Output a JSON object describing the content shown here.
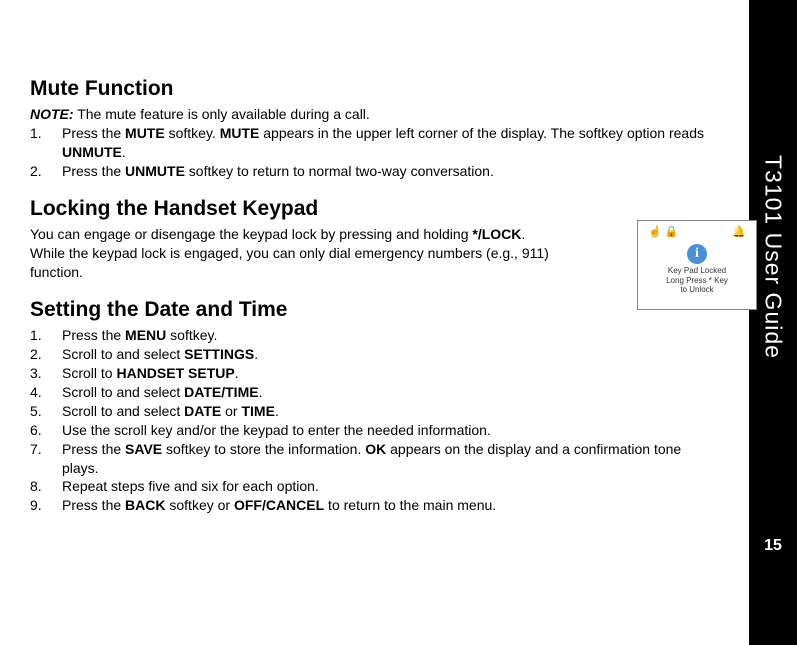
{
  "sidebar": {
    "title": "T3101 User Guide",
    "page_number": "15"
  },
  "section1": {
    "heading": "Mute Function",
    "note_label": "NOTE:",
    "note_text": " The mute feature is only available during a call.",
    "steps": [
      {
        "num": "1.",
        "pre": "Press the ",
        "b1": "MUTE",
        "mid1": " softkey. ",
        "b2": "MUTE",
        "mid2": " appears in the upper left corner of the display. The softkey option reads ",
        "b3": "UNMUTE",
        "post": "."
      },
      {
        "num": "2.",
        "pre": "Press the ",
        "b1": "UNMUTE",
        "mid1": " softkey to return to normal two-way conversation.",
        "b2": "",
        "mid2": "",
        "b3": "",
        "post": ""
      }
    ]
  },
  "section2": {
    "heading": "Locking the Handset Keypad",
    "para_pre": "You can engage or disengage the keypad lock by pressing and holding ",
    "para_bold": "*/LOCK",
    "para_post": ". While the keypad lock is engaged, you can only dial emergency numbers (e.g., 911) function."
  },
  "section3": {
    "heading": "Setting the Date and Time",
    "steps": [
      {
        "num": "1.",
        "parts": [
          "Press the ",
          "MENU",
          " softkey."
        ]
      },
      {
        "num": "2.",
        "parts": [
          "Scroll to and select ",
          "SETTINGS",
          "."
        ]
      },
      {
        "num": "3.",
        "parts": [
          "Scroll to ",
          "HANDSET SETUP",
          "."
        ]
      },
      {
        "num": "4.",
        "parts": [
          "Scroll to and select ",
          "DATE/TIME",
          "."
        ]
      },
      {
        "num": "5.",
        "parts": [
          "Scroll to and select ",
          "DATE",
          " or ",
          "TIME",
          "."
        ]
      },
      {
        "num": "6.",
        "parts": [
          "Use the scroll key and/or the keypad to enter the needed information."
        ]
      },
      {
        "num": "7.",
        "parts": [
          "Press the ",
          "SAVE",
          " softkey to store the information. ",
          "OK",
          " appears on the display and a confirmation tone plays."
        ]
      },
      {
        "num": "8.",
        "parts": [
          "Repeat steps five and six for each option."
        ]
      },
      {
        "num": "9.",
        "parts": [
          "Press the ",
          "BACK",
          " softkey or ",
          "OFF/CANCEL",
          " to return to the main menu."
        ]
      }
    ]
  },
  "figure": {
    "line1": "Key Pad Locked",
    "line2": "Long Press * Key",
    "line3": "to Unlock",
    "info_glyph": "i"
  }
}
